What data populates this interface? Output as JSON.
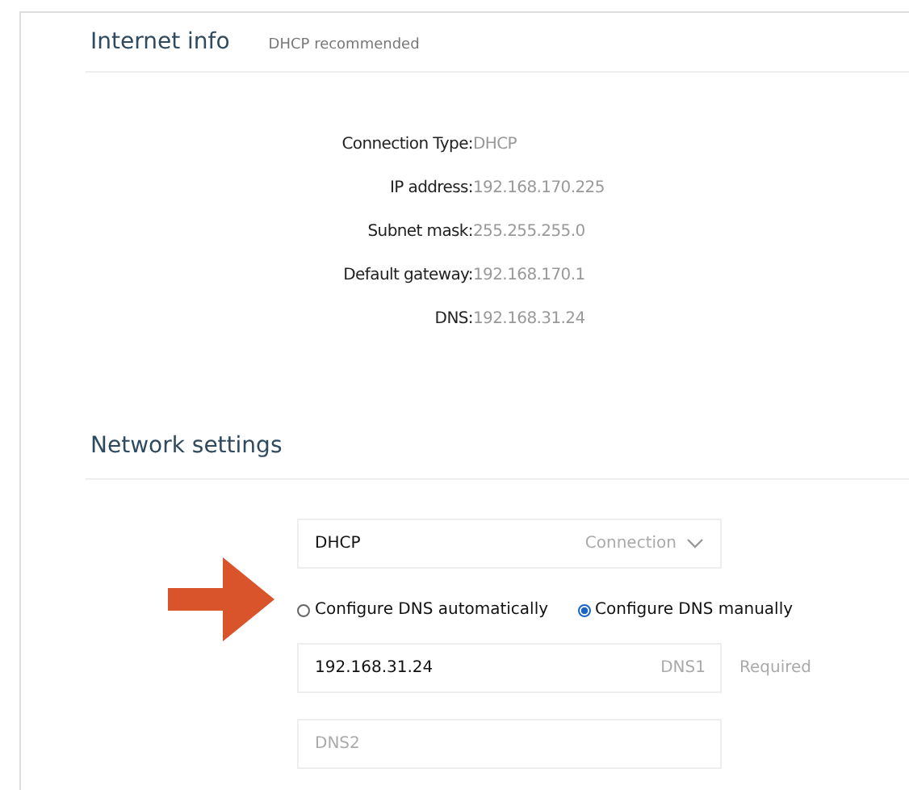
{
  "internet_info": {
    "title": "Internet info",
    "hint": "DHCP recommended",
    "rows": [
      {
        "label": "Connection Type:",
        "value": "DHCP"
      },
      {
        "label": "IP address:",
        "value": "192.168.170.225"
      },
      {
        "label": "Subnet mask:",
        "value": "255.255.255.0"
      },
      {
        "label": "Default gateway:",
        "value": "192.168.170.1"
      },
      {
        "label": "DNS:",
        "value": "192.168.31.24"
      }
    ]
  },
  "network_settings": {
    "title": "Network settings",
    "connection": {
      "value": "DHCP",
      "label": "Connection"
    },
    "dns_modes": [
      {
        "label": "Configure DNS automatically",
        "selected": false
      },
      {
        "label": "Configure DNS manually",
        "selected": true
      }
    ],
    "dns_fields": [
      {
        "value": "192.168.31.24",
        "label": "DNS1",
        "note": "Required"
      },
      {
        "placeholder": "DNS2"
      }
    ]
  }
}
